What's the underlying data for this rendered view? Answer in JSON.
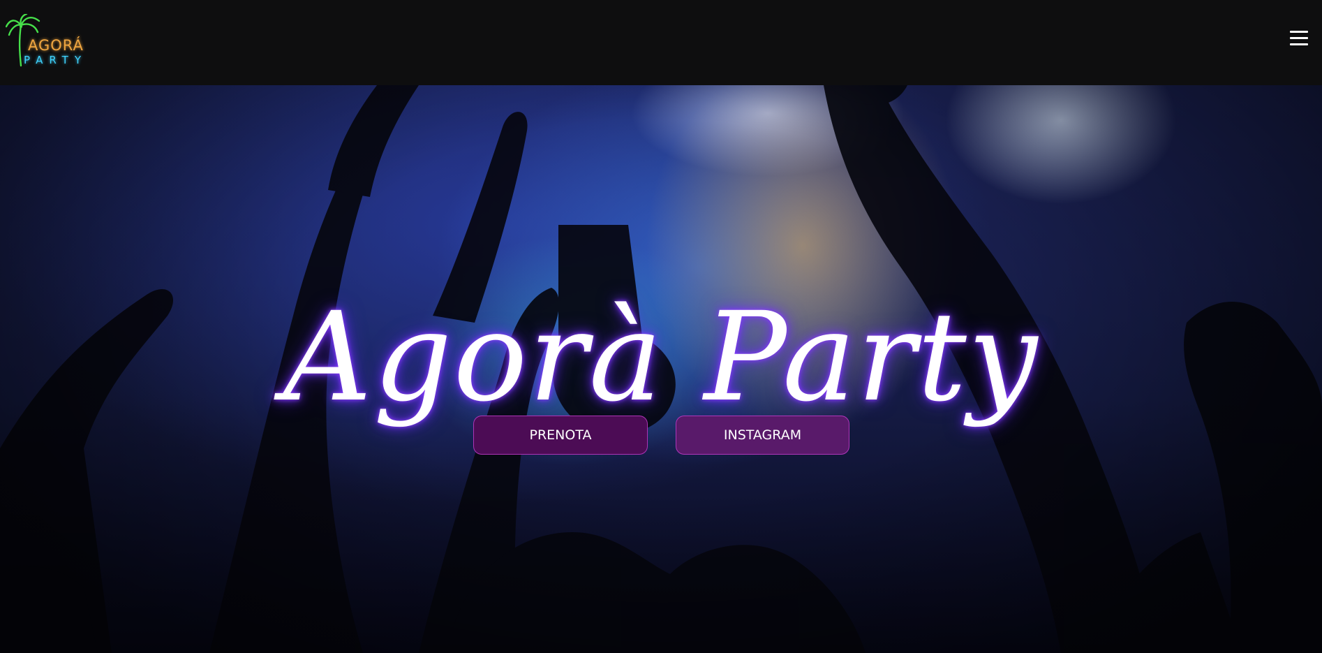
{
  "header": {
    "logo": {
      "line1": "AGORÁ",
      "line2": "PARTY",
      "icon": "palm-tree-icon",
      "colors": {
        "palm": "#46e04a",
        "line1": "#f0a640",
        "line2": "#3fd4ff"
      }
    },
    "menu_icon": "hamburger-menu-icon"
  },
  "hero": {
    "title": "Agorà Party",
    "title_glow_color": "#7a32ff",
    "buttons": [
      {
        "label": "PRENOTA",
        "color": "#4c0c55"
      },
      {
        "label": "INSTAGRAM",
        "color": "#591a6a"
      }
    ]
  }
}
